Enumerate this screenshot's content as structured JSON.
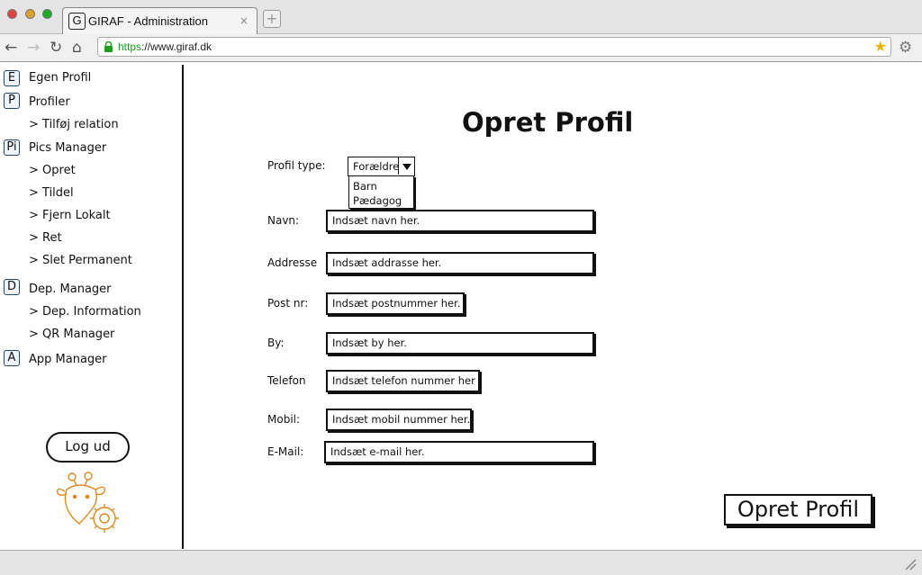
{
  "browser": {
    "tab": {
      "favicon": "G",
      "title": "GIRAF - Administration",
      "close": "×"
    },
    "url_scheme": "https",
    "url_rest": "://www.giraf.dk",
    "icons": [
      "back-icon",
      "forward-icon",
      "reload-icon",
      "home-icon",
      "lock-icon",
      "star-icon",
      "settings-icon",
      "new-tab-icon"
    ]
  },
  "sidebar": {
    "items": [
      {
        "badge": "E",
        "label": "Egen Profil"
      },
      {
        "badge": "P",
        "label": "Profiler",
        "subitems": [
          "> Tilføj relation"
        ]
      },
      {
        "badge": "Pi",
        "label": "Pics Manager",
        "subitems": [
          "> Opret",
          "> Tildel",
          "> Fjern Lokalt",
          "> Ret",
          "> Slet Permanent"
        ]
      },
      {
        "badge": "D",
        "label": "Dep. Manager",
        "subitems": [
          "> Dep. Information",
          "> QR Manager"
        ]
      },
      {
        "badge": "A",
        "label": "App Manager"
      }
    ],
    "logout": "Log ud"
  },
  "form": {
    "title": "Opret Profil",
    "profile_type": {
      "label": "Profil type:",
      "value": "Forældre",
      "options": [
        "Barn",
        "Pædagog"
      ]
    },
    "fields": [
      {
        "label": "Navn:",
        "placeholder": "Indsæt navn her."
      },
      {
        "label": "Addresse",
        "placeholder": "Indsæt addrasse her."
      },
      {
        "label": "Post nr:",
        "placeholder": "Indsæt postnummer her."
      },
      {
        "label": "By:",
        "placeholder": "Indsæt by her."
      },
      {
        "label": "Telefon",
        "placeholder": "Indsæt telefon nummer her"
      },
      {
        "label": "Mobil:",
        "placeholder": "Indsæt mobil nummer her."
      },
      {
        "label": "E-Mail:",
        "placeholder": "Indsæt e-mail her."
      }
    ],
    "submit": "Opret Profil"
  },
  "colors": {
    "accent_badge": "#22466a",
    "logo": "#e08a1e",
    "https": "#1f9d1f"
  }
}
